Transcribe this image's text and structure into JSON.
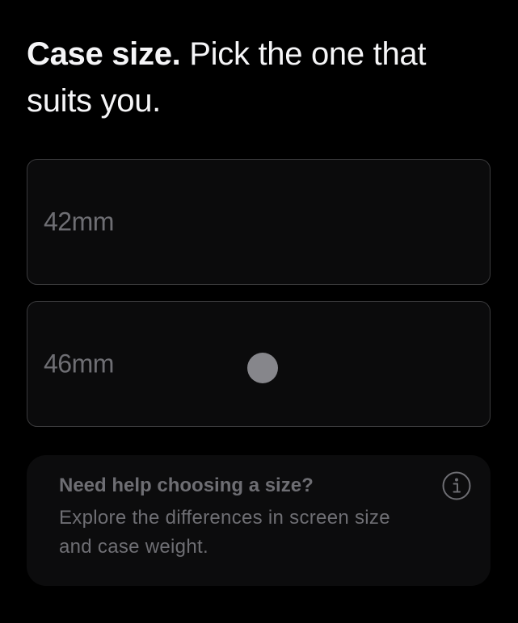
{
  "header": {
    "title_strong": "Case size.",
    "title_rest": " Pick the one that suits you."
  },
  "options": [
    {
      "label": "42mm"
    },
    {
      "label": "46mm"
    }
  ],
  "help": {
    "title": "Need help choosing a size?",
    "body": "Explore the differences in screen size and case weight.",
    "icon": "info-icon"
  },
  "colors": {
    "background": "#000000",
    "heading_text": "#f5f5f7",
    "muted_text": "#6e6e73",
    "option_border": "#3a3a3c",
    "cursor_dot": "#86868b"
  }
}
